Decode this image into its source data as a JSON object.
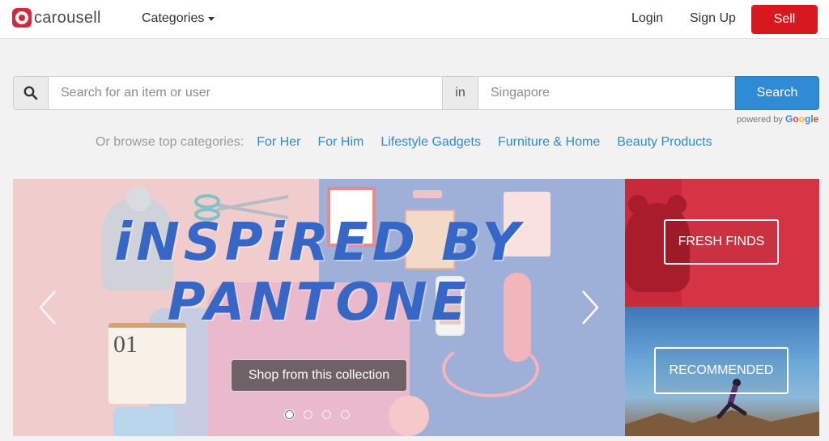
{
  "header": {
    "logo_text": "carousell",
    "categories_label": "Categories",
    "login_label": "Login",
    "signup_label": "Sign Up",
    "sell_label": "Sell",
    "brand_color": "#d7181f"
  },
  "search": {
    "placeholder": "Search for an item or user",
    "in_label": "in",
    "location_placeholder": "Singapore",
    "button_label": "Search",
    "powered_by": "powered by",
    "google": [
      "G",
      "o",
      "o",
      "g",
      "l",
      "e"
    ],
    "accent_color": "#2f8bd3"
  },
  "browse": {
    "label": "Or browse top categories:",
    "links": [
      "For Her",
      "For Him",
      "Lifestyle Gadgets",
      "Furniture & Home",
      "Beauty Products"
    ]
  },
  "hero": {
    "title_line1": "iNSPiRED BY",
    "title_line2": "PANTONE",
    "calendar_number": "01",
    "cta_label": "Shop from this collection",
    "dots_count": 4,
    "active_dot": 0,
    "prev_icon": "chevron-left-icon",
    "next_icon": "chevron-right-icon"
  },
  "tiles": {
    "fresh_label": "FRESH FINDS",
    "recommended_label": "RECOMMENDED"
  }
}
